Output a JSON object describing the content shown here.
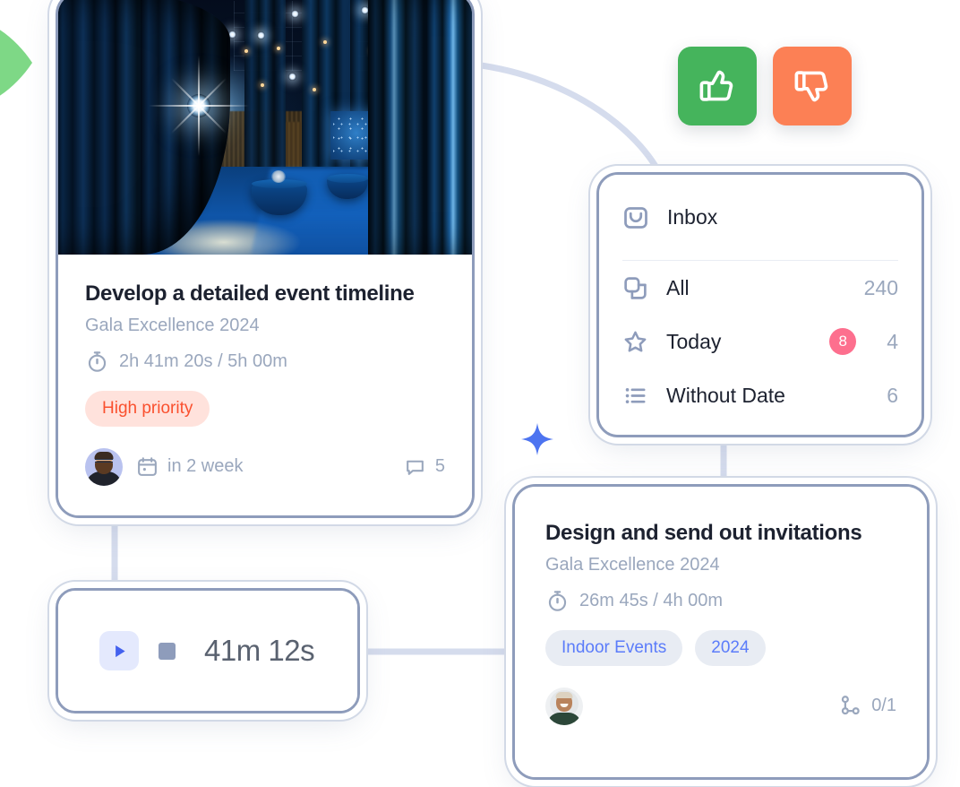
{
  "task_card_1": {
    "image_alt": "gala-event-hall-photo",
    "title": "Develop a detailed event timeline",
    "project": "Gala Excellence 2024",
    "time_icon": "stopwatch-icon",
    "time_tracked": "2h 41m 20s / 5h 00m",
    "priority_label": "High priority",
    "priority_color": "#fa502e",
    "priority_bg": "#ffe2dc",
    "assignee_alt": "bearded-man-avatar",
    "due_icon": "calendar-icon",
    "due_label": "in 2 week",
    "comment_icon": "comment-icon",
    "comment_count": "5"
  },
  "task_card_2": {
    "title": "Design and send out invitations",
    "project": "Gala Excellence 2024",
    "time_icon": "stopwatch-icon",
    "time_tracked": "26m 45s / 4h 00m",
    "tags": [
      {
        "label": "Indoor Events"
      },
      {
        "label": "2024"
      }
    ],
    "tag_color": "#5b7cfa",
    "tag_bg": "#e8ecf3",
    "assignee_alt": "smiling-woman-avatar",
    "subtask_icon": "subtask-branch-icon",
    "subtask_count": "0/1"
  },
  "timer": {
    "play_icon": "play-icon",
    "stop_icon": "stop-icon",
    "elapsed": "41m 12s",
    "accent": "#4361ee"
  },
  "inbox_panel": {
    "header": {
      "icon": "inbox-tray-icon",
      "label": "Inbox"
    },
    "rows": [
      {
        "icon": "copy-layers-icon",
        "label": "All",
        "badge": null,
        "count": "240"
      },
      {
        "icon": "star-icon",
        "label": "Today",
        "badge": "8",
        "count": "4"
      },
      {
        "icon": "list-icon",
        "label": "Without Date",
        "badge": null,
        "count": "6"
      }
    ],
    "badge_color": "#fd6f8e",
    "muted_color": "#9aa7bd"
  },
  "feedback": {
    "thumbs_up": {
      "icon": "thumbs-up-icon",
      "label": "Thumbs up",
      "color": "#45b45c"
    },
    "thumbs_down": {
      "icon": "thumbs-down-icon",
      "label": "Thumbs down",
      "color": "#fc8055"
    }
  },
  "decorations": {
    "cursor": {
      "icon": "cursor-pointer-icon",
      "color": "#7ed886"
    },
    "sparkle": {
      "icon": "sparkle-star-icon",
      "color": "#4d74f0"
    },
    "connector_color": "#d5dced",
    "card_border_color": "#8e9cbb"
  }
}
